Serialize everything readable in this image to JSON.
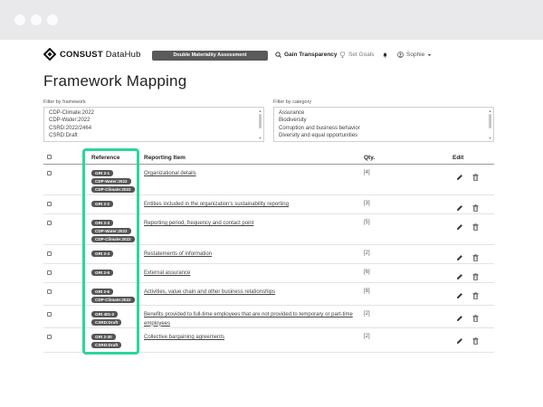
{
  "app": {
    "brand_bold": "CONSUST",
    "brand_light": "DataHub",
    "nav_pill": "Double Materiality Assessment",
    "nav_gain": "Gain Transparency",
    "nav_goals": "Set Goals",
    "nav_user": "Sophie"
  },
  "page": {
    "title": "Framework Mapping"
  },
  "filters": {
    "framework_label": "Filter by framework",
    "framework_options": [
      "CDP-Climate:2022",
      "CDP-Water:2022",
      "CSRD:2022/2464",
      "CSRD:Draft"
    ],
    "category_label": "Filter by category",
    "category_options": [
      "Assurance",
      "Biodiversity",
      "Corruption and business behavior",
      "Diversity and equal opportunities"
    ]
  },
  "table": {
    "headers": {
      "reference": "Reference",
      "item": "Reporting Item",
      "qty": "Qty.",
      "edit": "Edit"
    },
    "rows": [
      {
        "refs": [
          "GRI 2-1",
          "CDP-Water:2022",
          "CDP-Climate:2022"
        ],
        "item": "Organizational details",
        "qty": "[4]"
      },
      {
        "refs": [
          "GRI 2-2"
        ],
        "item": "Entities included in the organization's sustainability reporting",
        "qty": "[3]"
      },
      {
        "refs": [
          "GRI 2-3",
          "CDP-Water:2022",
          "CDP-Climate:2022"
        ],
        "item": "Reporting period, frequency and contact point",
        "qty": "[5]"
      },
      {
        "refs": [
          "GRI 2-4"
        ],
        "item": "Restatements of information",
        "qty": "[2]"
      },
      {
        "refs": [
          "GRI 2-5"
        ],
        "item": "External assurance",
        "qty": "[6]"
      },
      {
        "refs": [
          "GRI 2-6",
          "CDP-Climate:2022"
        ],
        "item": "Activities, value chain and other business relationships",
        "qty": "[8]"
      },
      {
        "refs": [
          "GRI 401-2",
          "CSRD:Draft"
        ],
        "item": "Benefits provided to full-time employees that are not provided to temporary or part-time employees",
        "qty": "[2]"
      },
      {
        "refs": [
          "GRI 2-30",
          "CSRD:Draft"
        ],
        "item": "Collective bargaining agreements",
        "qty": "[2]"
      }
    ]
  },
  "colors": {
    "highlight": "#2dd4a0",
    "badge": "#555555",
    "pill": "#5a5a5a"
  }
}
